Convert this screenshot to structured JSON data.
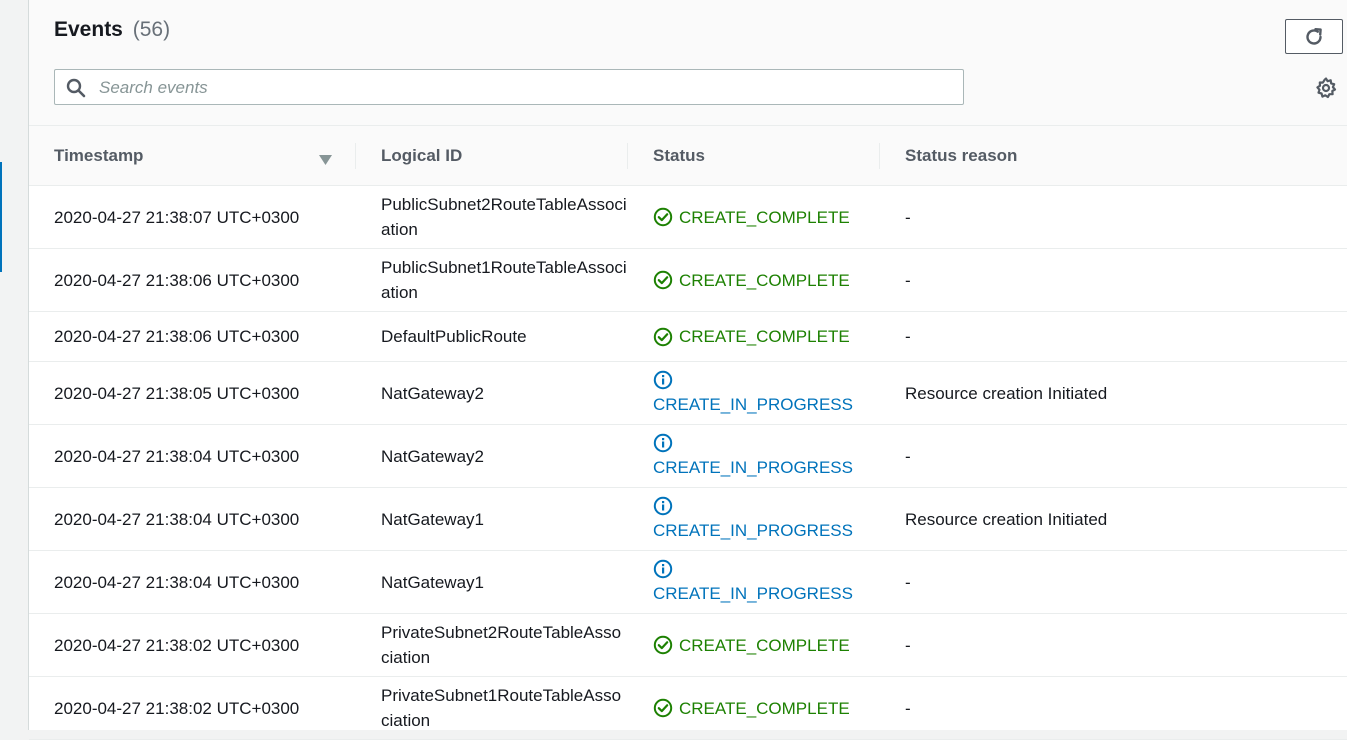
{
  "header": {
    "title": "Events",
    "count": "(56)"
  },
  "search": {
    "placeholder": "Search events",
    "value": ""
  },
  "columns": {
    "timestamp": "Timestamp",
    "logical_id": "Logical ID",
    "status": "Status",
    "status_reason": "Status reason"
  },
  "rows": [
    {
      "timestamp": "2020-04-27 21:38:07 UTC+0300",
      "logical_id": "PublicSubnet2RouteTableAssociation",
      "status": "CREATE_COMPLETE",
      "reason": "-"
    },
    {
      "timestamp": "2020-04-27 21:38:06 UTC+0300",
      "logical_id": "PublicSubnet1RouteTableAssociation",
      "status": "CREATE_COMPLETE",
      "reason": "-"
    },
    {
      "timestamp": "2020-04-27 21:38:06 UTC+0300",
      "logical_id": "DefaultPublicRoute",
      "status": "CREATE_COMPLETE",
      "reason": "-"
    },
    {
      "timestamp": "2020-04-27 21:38:05 UTC+0300",
      "logical_id": "NatGateway2",
      "status": "CREATE_IN_PROGRESS",
      "reason": "Resource creation Initiated"
    },
    {
      "timestamp": "2020-04-27 21:38:04 UTC+0300",
      "logical_id": "NatGateway2",
      "status": "CREATE_IN_PROGRESS",
      "reason": "-"
    },
    {
      "timestamp": "2020-04-27 21:38:04 UTC+0300",
      "logical_id": "NatGateway1",
      "status": "CREATE_IN_PROGRESS",
      "reason": "Resource creation Initiated"
    },
    {
      "timestamp": "2020-04-27 21:38:04 UTC+0300",
      "logical_id": "NatGateway1",
      "status": "CREATE_IN_PROGRESS",
      "reason": "-"
    },
    {
      "timestamp": "2020-04-27 21:38:02 UTC+0300",
      "logical_id": "PrivateSubnet2RouteTableAssociation",
      "status": "CREATE_COMPLETE",
      "reason": "-"
    },
    {
      "timestamp": "2020-04-27 21:38:02 UTC+0300",
      "logical_id": "PrivateSubnet1RouteTableAssociation",
      "status": "CREATE_COMPLETE",
      "reason": "-"
    }
  ],
  "icons": {
    "refresh": "refresh-icon",
    "search": "search-icon",
    "settings": "gear-icon",
    "sort": "sort-down-icon",
    "complete": "check-circle-icon",
    "in_progress": "info-circle-icon"
  },
  "colors": {
    "complete": "#1d8102",
    "in_progress": "#0073bb",
    "accent": "#0073bb"
  }
}
